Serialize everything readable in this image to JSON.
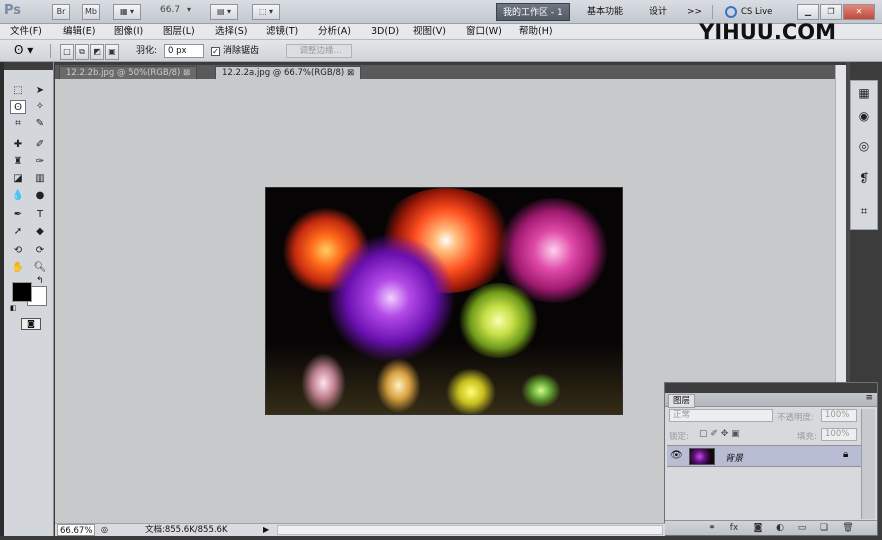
{
  "titlebar": {
    "ps_logo": "Ps",
    "br_label": "Br",
    "mb_label": "Mb",
    "zoom_value": "66.7",
    "workspace_active": "我的工作区 - 1",
    "workspace_basic": "基本功能",
    "workspace_design": "设计",
    "more_label": ">>",
    "cslive_label": "CS Live"
  },
  "menubar": {
    "items": [
      "文件(F)",
      "编辑(E)",
      "图像(I)",
      "图层(L)",
      "选择(S)",
      "滤镜(T)",
      "分析(A)",
      "3D(D)",
      "视图(V)",
      "窗口(W)",
      "帮助(H)"
    ]
  },
  "watermark": "YIHUU.COM",
  "options": {
    "feather_label": "羽化:",
    "feather_value": "0 px",
    "antialias_label": "消除锯齿",
    "antialias_checked": true,
    "refine_edge_label": "调整边缘..."
  },
  "documents": {
    "tabs": [
      {
        "label": "12.2.2b.jpg @ 50%(RGB/8)",
        "active": false
      },
      {
        "label": "12.2.2a.jpg @ 66.7%(RGB/8)",
        "active": true
      }
    ],
    "close_glyph": "⊠"
  },
  "statusbar": {
    "zoom": "66.67%",
    "doc_info": "文档:855.6K/855.6K"
  },
  "layers_panel": {
    "title": "图层",
    "blend_mode": "正常",
    "opacity_label": "不透明度:",
    "opacity_value": "100%",
    "lock_label": "锁定:",
    "fill_label": "填充:",
    "fill_value": "100%",
    "layer_name": "背景"
  },
  "colors": {
    "foreground": "#000000",
    "background": "#ffffff",
    "workspace_active_bg": "#5d6570",
    "canvas_bg": "#c7c9cb",
    "layer_selected": "#b9bdd4"
  }
}
